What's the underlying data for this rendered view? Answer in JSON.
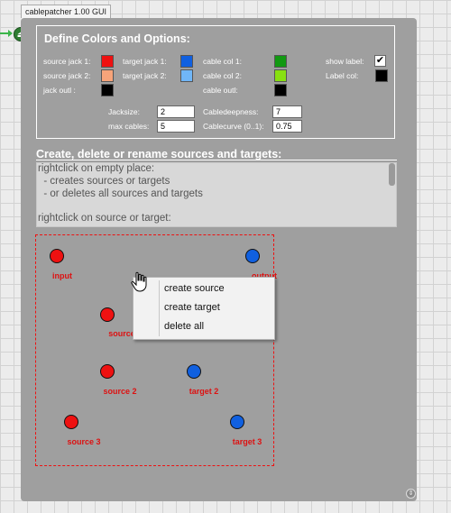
{
  "window": {
    "tab_title": "cablepatcher 1.00 GUI"
  },
  "outlet": {
    "glyph": "⏏",
    "color": "#2e7d32"
  },
  "options": {
    "title": "Define Colors and Options:",
    "source_jack_1": {
      "label": "source jack 1:",
      "color": "#ee1111"
    },
    "source_jack_2": {
      "label": "source jack 2:",
      "color": "#f7a47a"
    },
    "jack_outline": {
      "label": "jack outl :",
      "color": "#000000"
    },
    "target_jack_1": {
      "label": "target jack 1:",
      "color": "#1060e0"
    },
    "target_jack_2": {
      "label": "target jack 2:",
      "color": "#70b6f7"
    },
    "cable_col_1": {
      "label": "cable col 1:",
      "color": "#129912"
    },
    "cable_col_2": {
      "label": "cable col 2:",
      "color": "#88e011"
    },
    "cable_outline": {
      "label": "cable outl:",
      "color": "#000000"
    },
    "show_label": {
      "label": "show label:",
      "checked": true,
      "glyph": "✔"
    },
    "label_col": {
      "label": "Label col:",
      "color": "#000000"
    },
    "jacksize": {
      "label": "Jacksize:",
      "value": "2"
    },
    "max_cables": {
      "label": "max cables:",
      "value": "5"
    },
    "cabledeepness": {
      "label": "Cabledeepness:",
      "value": "7"
    },
    "cablecurve": {
      "label": "Cablecurve (0..1):",
      "value": "0.75"
    }
  },
  "help": {
    "title": "Create, delete or rename sources and targets:",
    "lines": [
      "rightclick on empty place:",
      "  - creates sources or targets",
      "  - or deletes all sources and targets",
      "",
      "rightclick on source or target:"
    ]
  },
  "canvas": {
    "nodes": [
      {
        "label": "input",
        "kind": "source"
      },
      {
        "label": "output",
        "kind": "target"
      },
      {
        "label": "source",
        "kind": "source"
      },
      {
        "label": "source 2",
        "kind": "source"
      },
      {
        "label": "target 2",
        "kind": "target"
      },
      {
        "label": "source 3",
        "kind": "source"
      },
      {
        "label": "target 3",
        "kind": "target"
      }
    ]
  },
  "context_menu": {
    "items": [
      "create source",
      "create target",
      "delete all"
    ]
  },
  "resize_glyph": "⇕"
}
